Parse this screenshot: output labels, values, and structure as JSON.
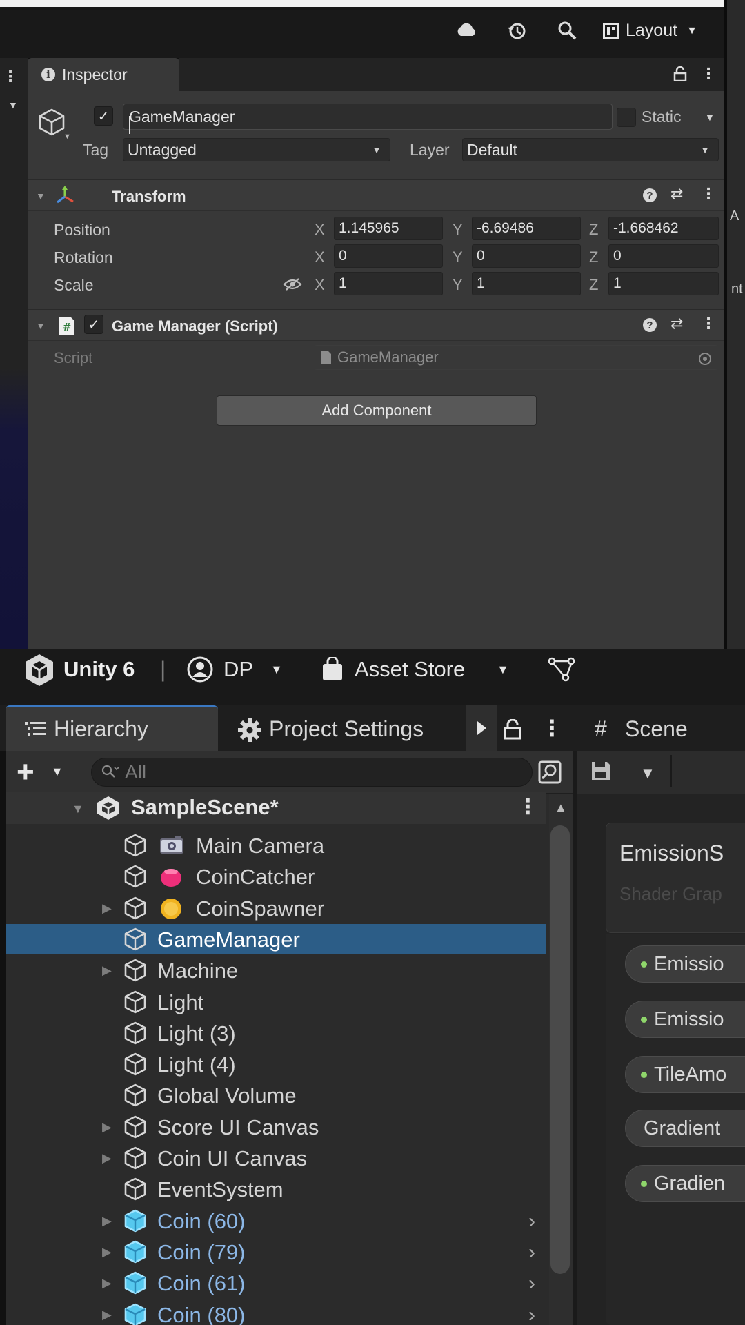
{
  "toolbar": {
    "layout_label": "Layout"
  },
  "inspector": {
    "tab_label": "Inspector",
    "object_name": "GameManager",
    "static_label": "Static",
    "tag_label": "Tag",
    "tag_value": "Untagged",
    "layer_label": "Layer",
    "layer_value": "Default",
    "transform": {
      "title": "Transform",
      "position_label": "Position",
      "rotation_label": "Rotation",
      "scale_label": "Scale",
      "axis_x": "X",
      "axis_y": "Y",
      "axis_z": "Z",
      "position": {
        "x": "1.145965",
        "y": "-6.69486",
        "z": "-1.668462"
      },
      "rotation": {
        "x": "0",
        "y": "0",
        "z": "0"
      },
      "scale": {
        "x": "1",
        "y": "1",
        "z": "1"
      }
    },
    "script_component": {
      "title": "Game Manager (Script)",
      "script_label": "Script",
      "script_value": "GameManager"
    },
    "add_component_label": "Add Component",
    "right_edge_1": "A",
    "right_edge_2": "nt"
  },
  "main_toolbar": {
    "title": "Unity 6",
    "separator": "|",
    "account_label": "DP",
    "asset_store_label": "Asset Store"
  },
  "tabs": {
    "hierarchy": "Hierarchy",
    "project_settings": "Project Settings",
    "scene": "Scene"
  },
  "hierarchy": {
    "search_placeholder": "All",
    "scene_name": "SampleScene*",
    "rows": [
      {
        "label": "Main Camera",
        "gizmo": "camera"
      },
      {
        "label": "CoinCatcher",
        "gizmo": "pink-ball"
      },
      {
        "label": "CoinSpawner",
        "gizmo": "coin"
      },
      {
        "label": "GameManager",
        "selected": true
      },
      {
        "label": "Machine"
      },
      {
        "label": "Light"
      },
      {
        "label": "Light (3)"
      },
      {
        "label": "Light (4)"
      },
      {
        "label": "Global Volume"
      },
      {
        "label": "Score UI Canvas"
      },
      {
        "label": "Coin UI Canvas"
      },
      {
        "label": "EventSystem"
      },
      {
        "label": "Coin (60)",
        "prefab": true
      },
      {
        "label": "Coin (79)",
        "prefab": true
      },
      {
        "label": "Coin (61)",
        "prefab": true
      },
      {
        "label": "Coin (80)",
        "prefab": true
      }
    ]
  },
  "shader_graph": {
    "title": "EmissionS",
    "subtitle": "Shader Grap",
    "properties": [
      {
        "label": "Emissio",
        "dot": true
      },
      {
        "label": "Emissio",
        "dot": true
      },
      {
        "label": "TileAmo",
        "dot": true
      },
      {
        "label": "Gradient",
        "dot": false
      },
      {
        "label": "Gradien",
        "dot": true
      }
    ]
  },
  "colors": {
    "accent": "#2c5d87",
    "panel": "#383838",
    "prefab_text": "#8cb7e6",
    "property_dot": "#8fd66b"
  }
}
